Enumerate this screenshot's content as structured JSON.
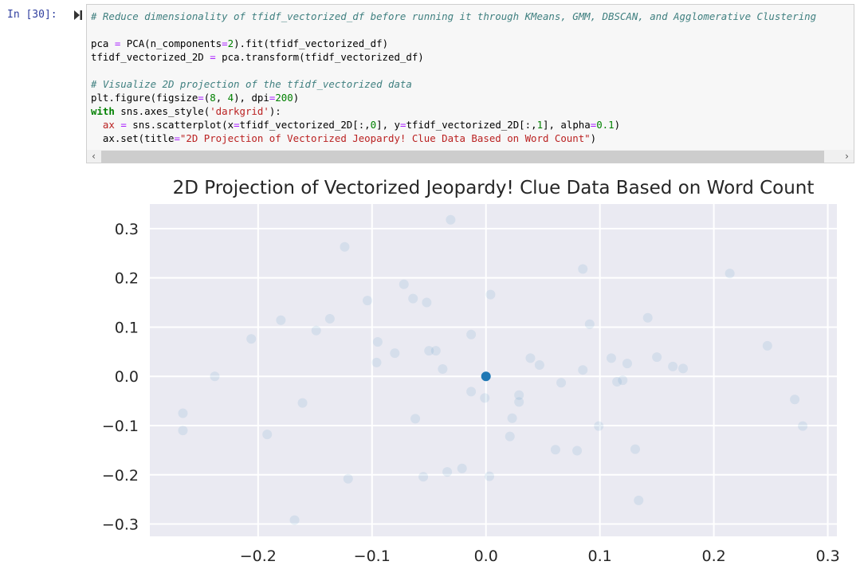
{
  "cell": {
    "prompt": "In [30]:",
    "run_icon": "run-cell-icon",
    "code_lines": [
      [
        {
          "t": "# Reduce dimensionality of tfidf_vectorized_df before running it through KMeans, GMM, DBSCAN, and Agglomerative Clustering",
          "c": "c-com"
        }
      ],
      [],
      [
        {
          "t": "pca "
        },
        {
          "t": "=",
          "c": "c-op"
        },
        {
          "t": " PCA(n_components"
        },
        {
          "t": "=",
          "c": "c-op"
        },
        {
          "t": "2",
          "c": "c-num"
        },
        {
          "t": ").fit(tfidf_vectorized_df)"
        }
      ],
      [
        {
          "t": "tfidf_vectorized_2D "
        },
        {
          "t": "=",
          "c": "c-op"
        },
        {
          "t": " pca.transform(tfidf_vectorized_df)"
        }
      ],
      [],
      [
        {
          "t": "# Visualize 2D projection of the tfidf_vectorized data",
          "c": "c-com"
        }
      ],
      [
        {
          "t": "plt.figure(figsize"
        },
        {
          "t": "=",
          "c": "c-op"
        },
        {
          "t": "("
        },
        {
          "t": "8",
          "c": "c-num"
        },
        {
          "t": ", "
        },
        {
          "t": "4",
          "c": "c-num"
        },
        {
          "t": "), dpi"
        },
        {
          "t": "=",
          "c": "c-op"
        },
        {
          "t": "200",
          "c": "c-num"
        },
        {
          "t": ")"
        }
      ],
      [
        {
          "t": "with",
          "c": "c-kw"
        },
        {
          "t": " sns.axes_style("
        },
        {
          "t": "'darkgrid'",
          "c": "c-str"
        },
        {
          "t": "):"
        }
      ],
      [
        {
          "t": "  "
        },
        {
          "t": "ax",
          "c": "c-var"
        },
        {
          "t": " "
        },
        {
          "t": "=",
          "c": "c-op"
        },
        {
          "t": " sns.scatterplot(x"
        },
        {
          "t": "=",
          "c": "c-op"
        },
        {
          "t": "tfidf_vectorized_2D[:,"
        },
        {
          "t": "0",
          "c": "c-num"
        },
        {
          "t": "], y"
        },
        {
          "t": "=",
          "c": "c-op"
        },
        {
          "t": "tfidf_vectorized_2D[:,"
        },
        {
          "t": "1",
          "c": "c-num"
        },
        {
          "t": "], alpha"
        },
        {
          "t": "=",
          "c": "c-op"
        },
        {
          "t": "0.1",
          "c": "c-num"
        },
        {
          "t": ")"
        }
      ],
      [
        {
          "t": "  ax.set(title"
        },
        {
          "t": "=",
          "c": "c-op"
        },
        {
          "t": "\"2D Projection of Vectorized Jeopardy! Clue Data Based on Word Count\"",
          "c": "c-str"
        },
        {
          "t": ")"
        }
      ]
    ],
    "scroll_left": "‹",
    "scroll_right": "›"
  },
  "chart_data": {
    "type": "scatter",
    "title": "2D Projection of Vectorized Jeopardy! Clue Data Based on Word Count",
    "xlabel": "",
    "ylabel": "",
    "xlim": [
      -0.295,
      0.308
    ],
    "ylim": [
      -0.325,
      0.35
    ],
    "xticks": [
      -0.2,
      -0.1,
      0.0,
      0.1,
      0.2,
      0.3
    ],
    "xtick_labels": [
      "−0.2",
      "−0.1",
      "0.0",
      "0.1",
      "0.2",
      "0.3"
    ],
    "yticks": [
      0.3,
      0.2,
      0.1,
      0.0,
      -0.1,
      -0.2,
      -0.3
    ],
    "ytick_labels": [
      "0.3",
      "0.2",
      "0.1",
      "0.0",
      "−0.1",
      "−0.2",
      "−0.3"
    ],
    "grid": true,
    "style": "darkgrid",
    "alpha": 0.1,
    "colors": {
      "point": "#1f77b4",
      "background": "#eaeaf2",
      "grid": "#ffffff"
    },
    "points": [
      {
        "x": -0.238,
        "y": 0.0
      },
      {
        "x": -0.266,
        "y": -0.075
      },
      {
        "x": -0.266,
        "y": -0.11
      },
      {
        "x": -0.192,
        "y": -0.118
      },
      {
        "x": -0.161,
        "y": -0.054
      },
      {
        "x": -0.121,
        "y": -0.208
      },
      {
        "x": -0.168,
        "y": -0.292
      },
      {
        "x": -0.206,
        "y": 0.076
      },
      {
        "x": -0.18,
        "y": 0.114
      },
      {
        "x": -0.149,
        "y": 0.093
      },
      {
        "x": -0.137,
        "y": 0.117
      },
      {
        "x": -0.124,
        "y": 0.263
      },
      {
        "x": -0.031,
        "y": 0.318
      },
      {
        "x": -0.072,
        "y": 0.187
      },
      {
        "x": -0.064,
        "y": 0.158
      },
      {
        "x": -0.052,
        "y": 0.15
      },
      {
        "x": -0.104,
        "y": 0.154
      },
      {
        "x": 0.004,
        "y": 0.166
      },
      {
        "x": -0.095,
        "y": 0.07
      },
      {
        "x": -0.08,
        "y": 0.047
      },
      {
        "x": -0.096,
        "y": 0.028
      },
      {
        "x": -0.05,
        "y": 0.052
      },
      {
        "x": -0.044,
        "y": 0.052
      },
      {
        "x": -0.038,
        "y": 0.015
      },
      {
        "x": -0.013,
        "y": 0.085
      },
      {
        "x": -0.013,
        "y": -0.031
      },
      {
        "x": -0.001,
        "y": -0.044
      },
      {
        "x": 0.029,
        "y": -0.038
      },
      {
        "x": 0.029,
        "y": -0.052
      },
      {
        "x": 0.023,
        "y": -0.085
      },
      {
        "x": -0.062,
        "y": -0.086
      },
      {
        "x": 0.021,
        "y": -0.122
      },
      {
        "x": 0.061,
        "y": -0.149
      },
      {
        "x": 0.08,
        "y": -0.151
      },
      {
        "x": 0.099,
        "y": -0.101
      },
      {
        "x": 0.066,
        "y": -0.013
      },
      {
        "x": 0.115,
        "y": -0.011
      },
      {
        "x": 0.12,
        "y": -0.008
      },
      {
        "x": -0.021,
        "y": -0.187
      },
      {
        "x": -0.034,
        "y": -0.194
      },
      {
        "x": -0.055,
        "y": -0.204
      },
      {
        "x": 0.003,
        "y": -0.203
      },
      {
        "x": 0.085,
        "y": 0.218
      },
      {
        "x": 0.091,
        "y": 0.106
      },
      {
        "x": 0.142,
        "y": 0.119
      },
      {
        "x": 0.214,
        "y": 0.209
      },
      {
        "x": 0.039,
        "y": 0.037
      },
      {
        "x": 0.047,
        "y": 0.023
      },
      {
        "x": 0.085,
        "y": 0.013
      },
      {
        "x": 0.11,
        "y": 0.037
      },
      {
        "x": 0.124,
        "y": 0.026
      },
      {
        "x": 0.15,
        "y": 0.039
      },
      {
        "x": 0.164,
        "y": 0.02
      },
      {
        "x": 0.173,
        "y": 0.016
      },
      {
        "x": 0.247,
        "y": 0.062
      },
      {
        "x": 0.271,
        "y": -0.047
      },
      {
        "x": 0.278,
        "y": -0.101
      },
      {
        "x": 0.131,
        "y": -0.148
      },
      {
        "x": 0.134,
        "y": -0.252
      }
    ],
    "dense_point": {
      "x": 0.0,
      "y": 0.0,
      "note": "many overlapping points (opaque)"
    }
  }
}
